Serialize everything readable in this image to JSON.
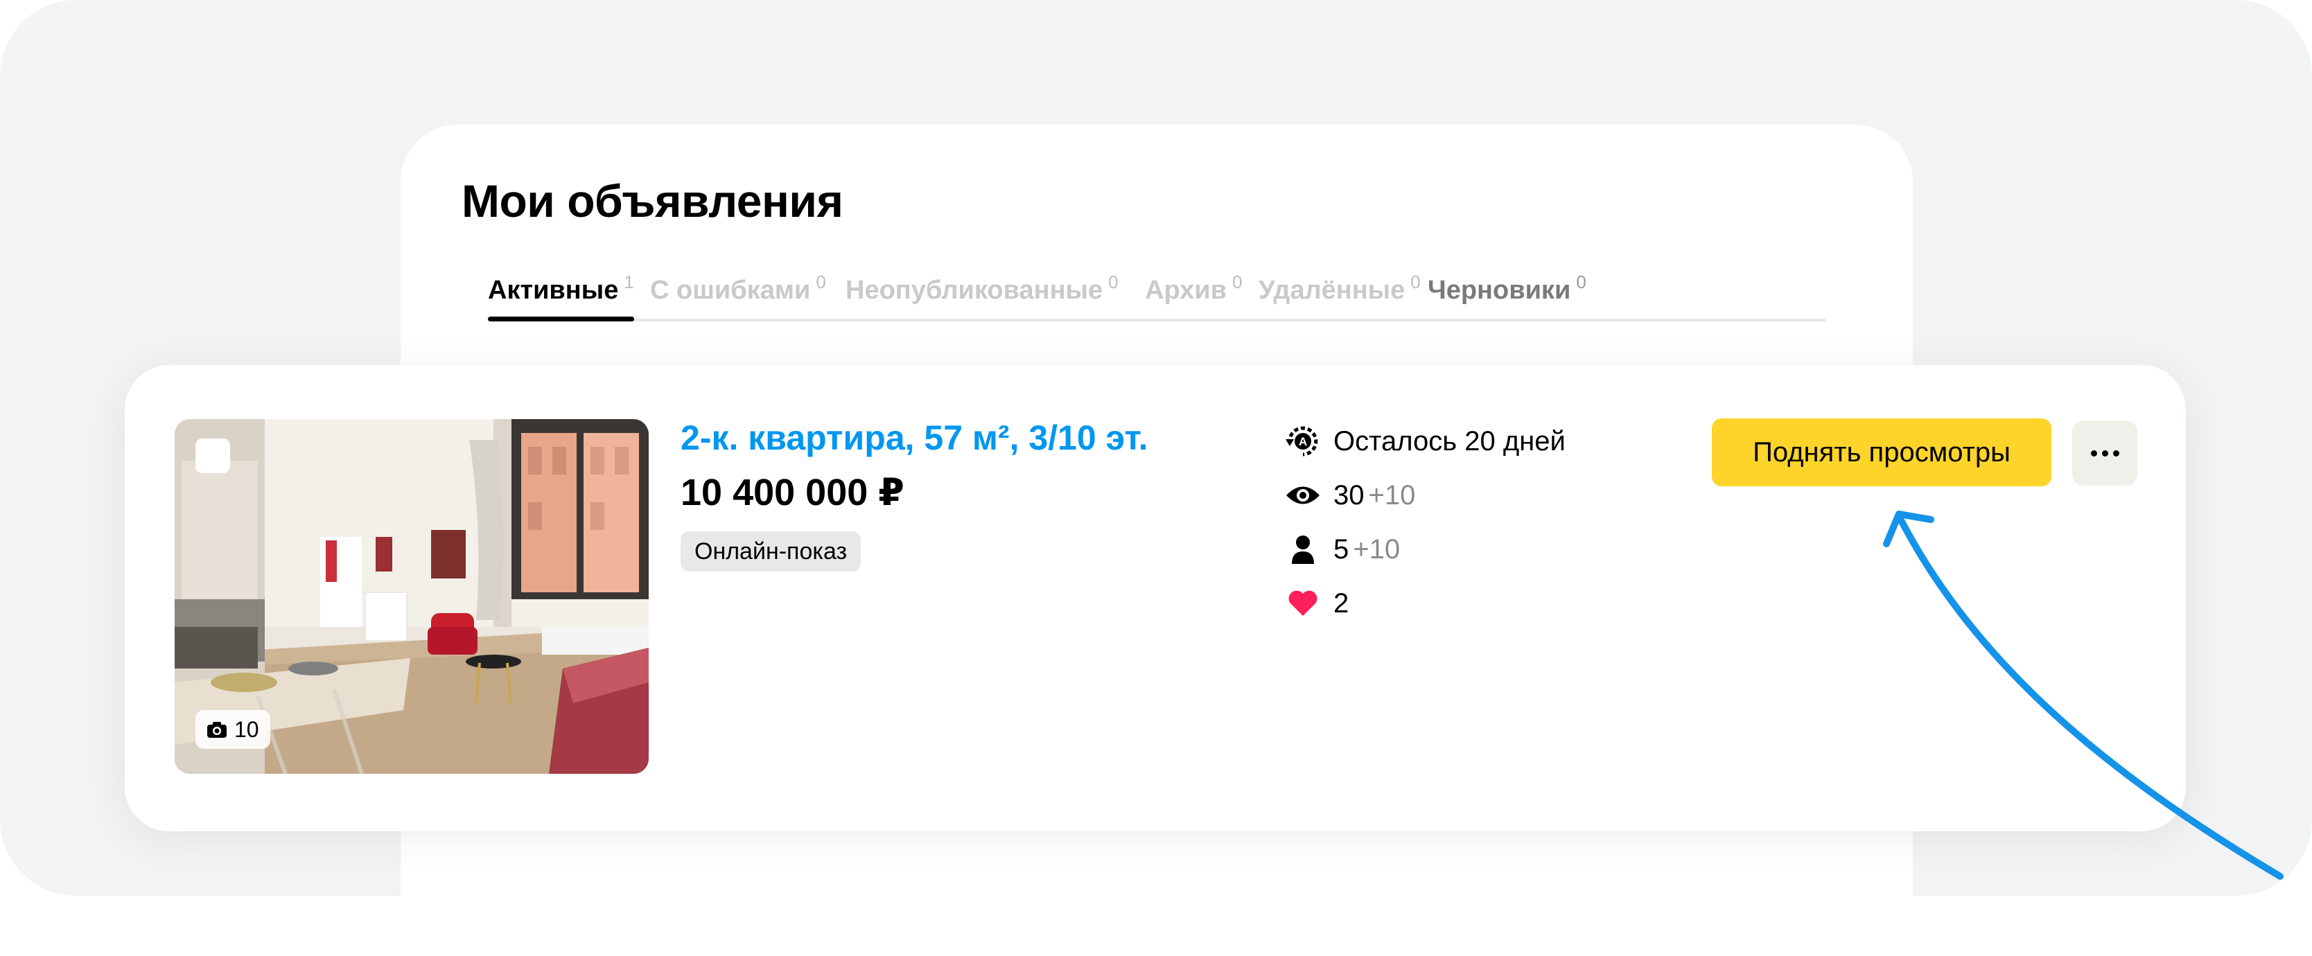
{
  "page": {
    "title": "Мои объявления",
    "tabs": [
      {
        "label": "Активные",
        "count": "1"
      },
      {
        "label": "С ошибками",
        "count": "0"
      },
      {
        "label": "Неопубликованные",
        "count": "0"
      },
      {
        "label": "Архив",
        "count": "0"
      },
      {
        "label": "Удалённые",
        "count": "0"
      },
      {
        "label": "Черновики",
        "count": "0"
      }
    ]
  },
  "listing": {
    "photo_count": "10",
    "title": "2-к. квартира, 57 м², 3/10 эт.",
    "price": "10 400 000 ₽",
    "badge": "Онлайн-показ",
    "stats": {
      "days_left": "Осталось 20 дней",
      "views": "30",
      "views_delta": "+10",
      "contacts": "5",
      "contacts_delta": "+10",
      "favorites": "2"
    },
    "boost_label": "Поднять просмотры",
    "more_icon": "more-dots-icon"
  },
  "colors": {
    "accent_link": "#0097f0",
    "boost_button": "#ffd42a",
    "heart": "#ff1f5a",
    "arrow": "#1593e9"
  }
}
